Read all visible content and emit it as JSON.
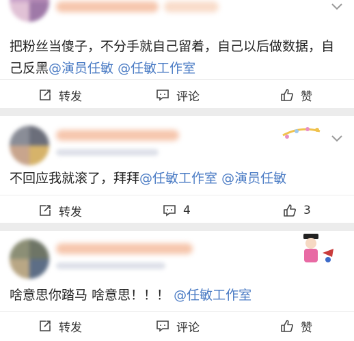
{
  "posts": [
    {
      "text": "把粉丝当傻子，不分手就自己留着，自己以后做数据，自己反黑",
      "mentions": [
        "@演员任敏",
        "@任敏工作室"
      ],
      "actions": {
        "repost": "转发",
        "comment": "评论",
        "like": "赞"
      }
    },
    {
      "text": "不回应我就滚了，拜拜",
      "mentions": [
        "@任敏工作室",
        "@演员任敏"
      ],
      "actions": {
        "repost": "转发",
        "comment": "4",
        "like": "3"
      }
    },
    {
      "text": "啥意思你踏马 啥意思！！！",
      "mentions": [
        "@任敏工作室"
      ],
      "actions": {
        "repost": "转发",
        "comment": "评论",
        "like": "赞"
      }
    }
  ],
  "icons": {
    "repost": "share-square-icon",
    "comment": "comment-bubble-icon",
    "like": "thumbs-up-icon",
    "menu": "chevron-down-icon"
  },
  "colors": {
    "mention": "#4a7bc4",
    "separator": "#ececec",
    "text": "#222222"
  }
}
